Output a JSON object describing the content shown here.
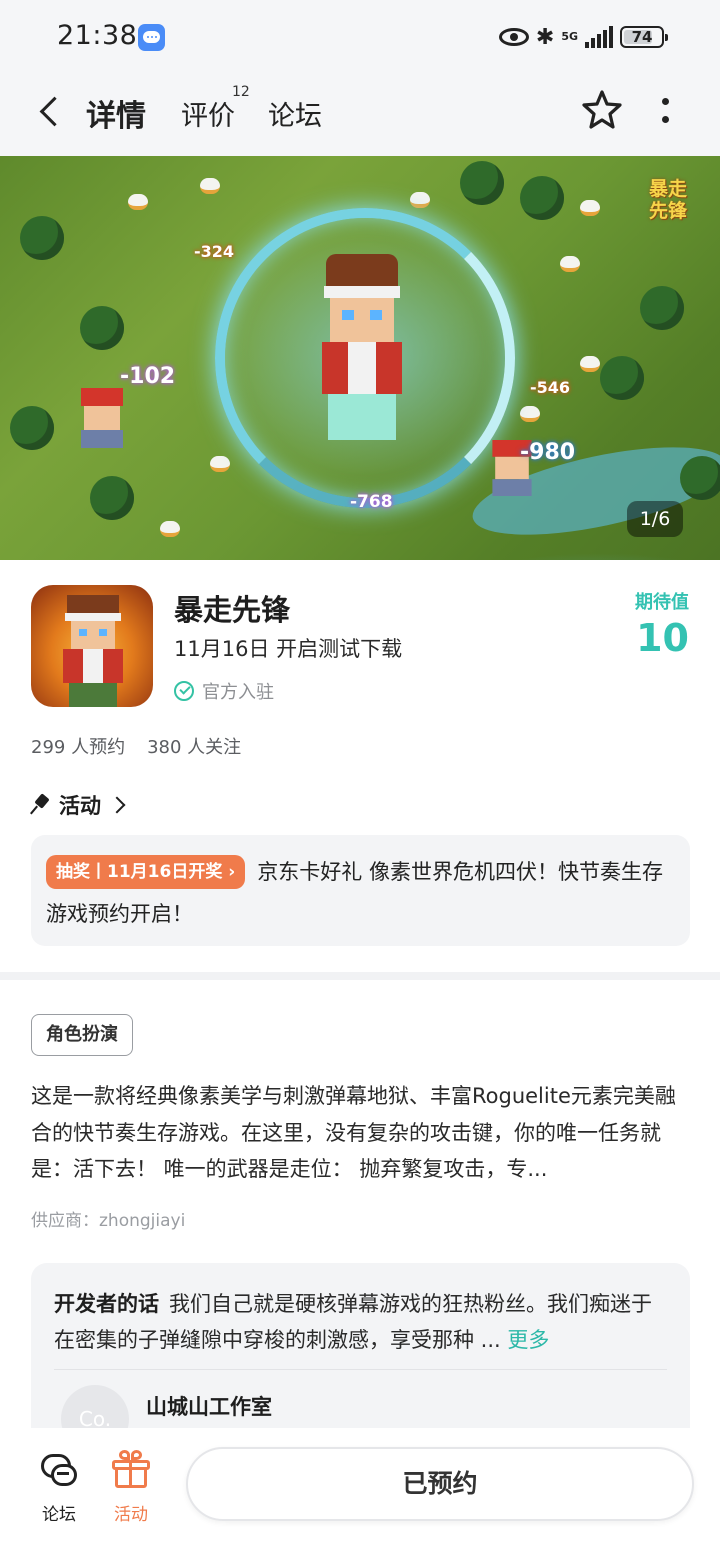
{
  "status_bar": {
    "time": "21:38",
    "network": "5G",
    "battery": "74"
  },
  "nav": {
    "tabs": [
      {
        "label": "详情",
        "active": true
      },
      {
        "label": "评价",
        "badge": "12"
      },
      {
        "label": "论坛"
      }
    ],
    "icons": [
      "back-icon",
      "star-icon",
      "more-icon"
    ]
  },
  "banner": {
    "logo_text": "暴走先锋",
    "damage_numbers": [
      "-324",
      "-102",
      "-546",
      "-980",
      "-768"
    ],
    "counter": "1/6"
  },
  "game": {
    "title": "暴走先锋",
    "date_text": "11月16日 开启测试下载",
    "official_label": "官方入驻",
    "expectation_label": "期待值",
    "expectation_value": "10",
    "reservations": "299 人预约",
    "followers": "380 人关注"
  },
  "activity": {
    "heading": "活动",
    "tag": "抽奖丨11月16日开奖",
    "text": "京东卡好礼 像素世界危机四伏！快节奏生存游戏预约开启！"
  },
  "details": {
    "genre_tag": "角色扮演",
    "description": "这是一款将经典像素美学与刺激弹幕地狱、丰富Roguelite元素完美融合的快节奏生存游戏。在这里，没有复杂的攻击键，你的唯一任务就是：活下去！ 唯一的武器是走位： 抛弃繁复攻击，专...",
    "supplier": "供应商：zhongjiayi"
  },
  "developer": {
    "heading": "开发者的话",
    "text": "我们自己就是硬核弹幕游戏的狂热粉丝。我们痴迷于在密集的子弹缝隙中穿梭的刺激感，享受那种 ...",
    "more_label": "更多",
    "avatar_text": "Co.",
    "studio_name": "山城山工作室"
  },
  "bottom_bar": {
    "forum_label": "论坛",
    "activity_label": "活动",
    "reserved_button": "已预约"
  },
  "colors": {
    "accent": "#2ec3b6",
    "expect": "#34c2b2",
    "orange": "#f07b4b"
  }
}
